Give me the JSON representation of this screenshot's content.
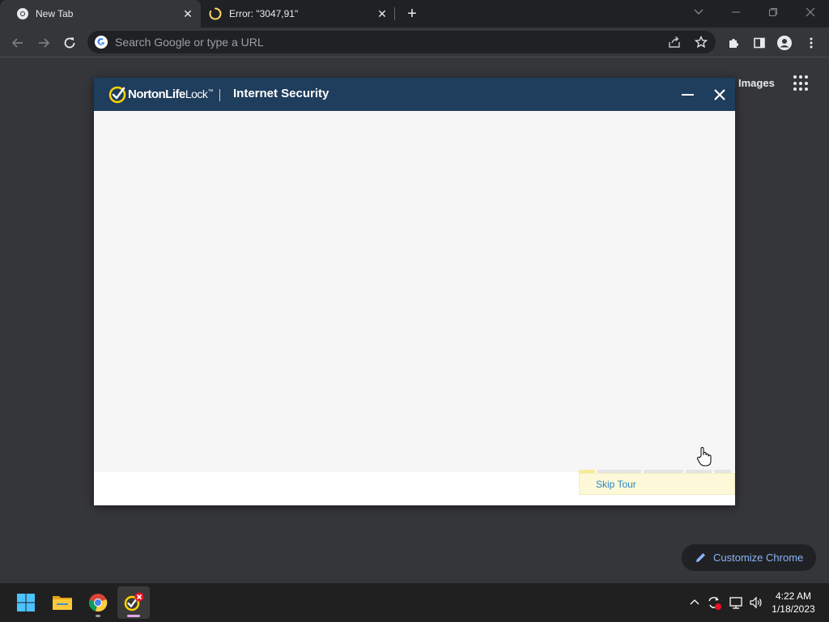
{
  "browser": {
    "tabs": [
      {
        "title": "New Tab",
        "icon": "chrome-icon",
        "active": true
      },
      {
        "title": "Error: \"3047,91\"",
        "icon": "loading-spinner-icon",
        "active": false
      }
    ],
    "omnibox": {
      "placeholder": "Search Google or type a URL",
      "value": ""
    }
  },
  "ntp": {
    "images_label": "Images",
    "customize_label": "Customize Chrome"
  },
  "norton": {
    "brand_main": "NortonLife",
    "brand_suffix": "Lock",
    "trademark": "™",
    "product": "Internet Security",
    "skip_tour_label": "Skip Tour",
    "tour_steps_total": 5,
    "tour_step_current": 1
  },
  "taskbar": {
    "apps": [
      "windows-start-icon",
      "file-explorer-icon",
      "chrome-icon",
      "norton-icon"
    ],
    "clock_time": "4:22 AM",
    "clock_date": "1/18/2023"
  },
  "colors": {
    "norton_header": "#1f3d5c",
    "norton_yellow": "#ffd400",
    "link_blue": "#2a86c7",
    "chrome_accent": "#8ab4f8"
  }
}
